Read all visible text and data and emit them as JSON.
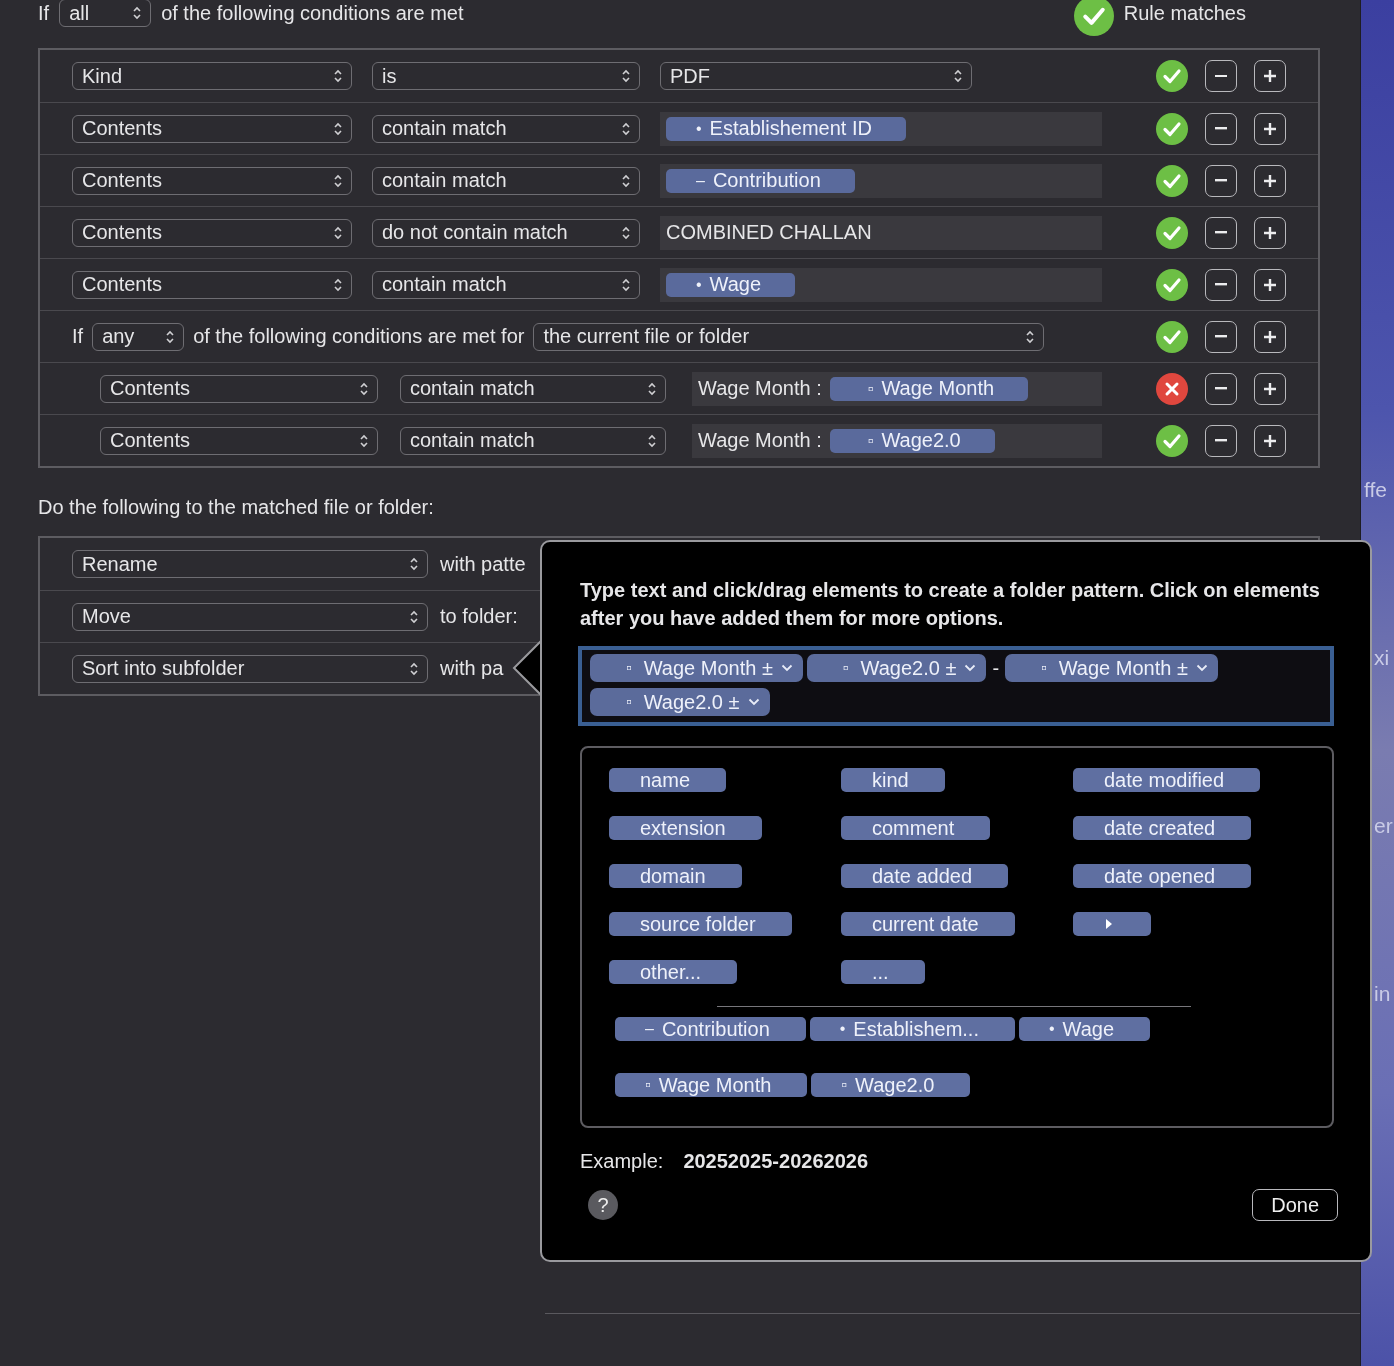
{
  "header": {
    "prefix": "If",
    "quantifier": "all",
    "suffix": "of the following conditions are met",
    "status_label": "Rule matches",
    "matched": true
  },
  "conditions": [
    {
      "kind": "condition",
      "attribute": "Kind",
      "operator": "is",
      "value": {
        "kind": "popup",
        "text": "PDF"
      },
      "matched": true
    },
    {
      "kind": "condition",
      "attribute": "Contents",
      "operator": "contain match",
      "value": {
        "kind": "tokens",
        "tokens": [
          {
            "marker": "•",
            "label": "Establishement ID"
          }
        ]
      },
      "matched": true
    },
    {
      "kind": "condition",
      "attribute": "Contents",
      "operator": "contain match",
      "value": {
        "kind": "tokens",
        "tokens": [
          {
            "marker": "–",
            "label": "Contribution"
          }
        ]
      },
      "matched": true
    },
    {
      "kind": "condition",
      "attribute": "Contents",
      "operator": "do not contain match",
      "value": {
        "kind": "text",
        "text": "COMBINED CHALLAN"
      },
      "matched": true
    },
    {
      "kind": "condition",
      "attribute": "Contents",
      "operator": "contain match",
      "value": {
        "kind": "tokens",
        "tokens": [
          {
            "marker": "•",
            "label": "Wage"
          }
        ]
      },
      "matched": true
    },
    {
      "kind": "group",
      "prefix": "If",
      "quantifier": "any",
      "suffix": "of the following conditions are met for",
      "target": "the current file or folder",
      "matched": true,
      "children": [
        {
          "kind": "condition",
          "attribute": "Contents",
          "operator": "contain match",
          "value": {
            "kind": "tokens",
            "prefix": "Wage Month :",
            "tokens": [
              {
                "marker": "▫",
                "label": "Wage Month"
              }
            ]
          },
          "matched": false
        },
        {
          "kind": "condition",
          "attribute": "Contents",
          "operator": "contain match",
          "value": {
            "kind": "tokens",
            "prefix": "Wage Month :",
            "tokens": [
              {
                "marker": "▫",
                "label": "Wage2.0"
              }
            ]
          },
          "matched": true
        }
      ]
    }
  ],
  "actions_title": "Do the following to the matched file or folder:",
  "actions": [
    {
      "action": "Rename",
      "detail": "with patte"
    },
    {
      "action": "Move",
      "detail": "to folder:"
    },
    {
      "action": "Sort into subfolder",
      "detail": "with pa"
    }
  ],
  "pattern_popover": {
    "instructions": "Type text and click/drag elements to create a folder pattern. Click on elements after you have added them for more options.",
    "pattern": [
      {
        "kind": "token",
        "marker": "▫",
        "label": "Wage Month",
        "suffix": "±"
      },
      {
        "kind": "token",
        "marker": "▫",
        "label": "Wage2.0",
        "suffix": "±"
      },
      {
        "kind": "text",
        "text": "-"
      },
      {
        "kind": "token",
        "marker": "▫",
        "label": "Wage Month",
        "suffix": "±"
      },
      {
        "kind": "token",
        "marker": "▫",
        "label": "Wage2.0",
        "suffix": "±"
      }
    ],
    "elements": [
      {
        "kind": "token",
        "label": "name"
      },
      {
        "kind": "token",
        "label": "kind"
      },
      {
        "kind": "token",
        "label": "date modified"
      },
      {
        "kind": "token",
        "label": "extension"
      },
      {
        "kind": "token",
        "label": "comment"
      },
      {
        "kind": "token",
        "label": "date created"
      },
      {
        "kind": "token",
        "label": "domain"
      },
      {
        "kind": "token",
        "label": "date added"
      },
      {
        "kind": "token",
        "label": "date opened"
      },
      {
        "kind": "token",
        "label": "source folder"
      },
      {
        "kind": "token",
        "label": "current date"
      },
      {
        "kind": "arrow"
      },
      {
        "kind": "token",
        "label": "other..."
      },
      {
        "kind": "token",
        "label": "..."
      }
    ],
    "recent_elements": [
      {
        "marker": "–",
        "label": "Contribution"
      },
      {
        "marker": "•",
        "label": "Establishem..."
      },
      {
        "marker": "•",
        "label": "Wage"
      },
      {
        "marker": "▫",
        "label": "Wage Month"
      },
      {
        "marker": "▫",
        "label": "Wage2.0"
      }
    ],
    "example_label": "Example:",
    "example": "20252025-20262026",
    "help": "?",
    "done": "Done"
  },
  "background_window": {
    "fragments": [
      "ffe",
      "xi",
      "er",
      "in"
    ]
  }
}
